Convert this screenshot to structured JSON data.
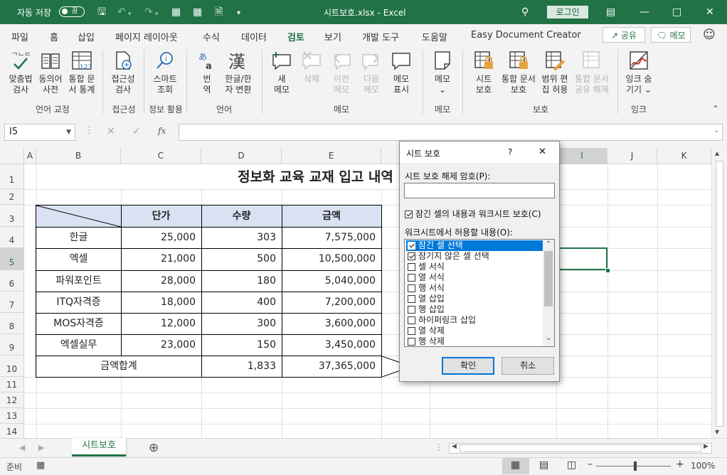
{
  "titlebar": {
    "autosave_label": "자동 저장",
    "autosave_state": "끔",
    "file_title": "시트보호.xlsx  -  Excel",
    "login_label": "로그인"
  },
  "menu": {
    "tabs": [
      "파일",
      "홈",
      "삽입",
      "페이지 레이아웃",
      "수식",
      "데이터",
      "검토",
      "보기",
      "개발 도구",
      "도움말",
      "Easy Document Creator"
    ],
    "active_tab": "검토",
    "share_label": "공유",
    "comment_label": "메모"
  },
  "ribbon": {
    "buttons": [
      {
        "l1": "맞춤법",
        "l2": "검사",
        "icon": "spellcheck-icon"
      },
      {
        "l1": "동의어",
        "l2": "사전",
        "icon": "thesaurus-icon"
      },
      {
        "l1": "통합 문",
        "l2": "서 통계",
        "icon": "workbook-statistics-icon"
      },
      {
        "l1": "접근성",
        "l2": "검사",
        "icon": "accessibility-icon"
      },
      {
        "l1": "스마트",
        "l2": "조회",
        "icon": "smart-lookup-icon"
      },
      {
        "l1": "번",
        "l2": "역",
        "icon": "translate-icon"
      },
      {
        "l1": "한글/한",
        "l2": "자 변환",
        "icon": "hangul-hanja-icon"
      },
      {
        "l1": "새",
        "l2": "메모",
        "icon": "new-comment-icon"
      },
      {
        "l1": "삭제",
        "l2": "",
        "icon": "delete-comment-icon",
        "disabled": true
      },
      {
        "l1": "이전",
        "l2": "메모",
        "icon": "previous-comment-icon",
        "disabled": true
      },
      {
        "l1": "다음",
        "l2": "메모",
        "icon": "next-comment-icon",
        "disabled": true
      },
      {
        "l1": "메모",
        "l2": "표시",
        "icon": "show-comments-icon"
      },
      {
        "l1": "메모",
        "l2": "⌄",
        "icon": "notes-icon"
      },
      {
        "l1": "시트",
        "l2": "보호",
        "icon": "protect-sheet-icon"
      },
      {
        "l1": "통합 문서",
        "l2": "보호",
        "icon": "protect-workbook-icon"
      },
      {
        "l1": "범위 편",
        "l2": "집 허용",
        "icon": "allow-edit-ranges-icon"
      },
      {
        "l1": "통합 문서",
        "l2": "공유 해제",
        "icon": "unshare-workbook-icon",
        "disabled": true
      },
      {
        "l1": "잉크 숨",
        "l2": "기기 ⌄",
        "icon": "hide-ink-icon"
      }
    ],
    "groups": [
      "언어 교정",
      "접근성",
      "정보 활용",
      "언어",
      "메모",
      "메모",
      "보호",
      "잉크"
    ]
  },
  "formula_bar": {
    "name_box": "I5",
    "fx": "fx",
    "formula": ""
  },
  "sheet": {
    "columns": [
      "A",
      "B",
      "C",
      "D",
      "E",
      "F",
      "G",
      "H",
      "I",
      "J",
      "K"
    ],
    "rows": [
      "1",
      "2",
      "3",
      "4",
      "5",
      "6",
      "7",
      "8",
      "9",
      "10",
      "11",
      "12",
      "13",
      "14"
    ],
    "selected_col": "I",
    "selected_row": "5",
    "title": "정보화 교육 교재 입고 내역",
    "headers": [
      "단가",
      "수량",
      "금액"
    ],
    "items": [
      {
        "name": "한글",
        "price": "25,000",
        "qty": "303",
        "amount": "7,575,000"
      },
      {
        "name": "엑셀",
        "price": "21,000",
        "qty": "500",
        "amount": "10,500,000"
      },
      {
        "name": "파워포인트",
        "price": "28,000",
        "qty": "180",
        "amount": "5,040,000"
      },
      {
        "name": "ITQ자격증",
        "price": "18,000",
        "qty": "400",
        "amount": "7,200,000"
      },
      {
        "name": "MOS자격증",
        "price": "12,000",
        "qty": "300",
        "amount": "3,600,000"
      },
      {
        "name": "엑셀실무",
        "price": "23,000",
        "qty": "150",
        "amount": "3,450,000"
      }
    ],
    "total": {
      "label": "금액합계",
      "qty": "1,833",
      "amount": "37,365,000"
    }
  },
  "dialog": {
    "title": "시트 보호",
    "help": "?",
    "close": "✕",
    "password_label": "시트 보호 해제 암호(P):",
    "password_value": "",
    "protect_label": "잠긴 셀의 내용과 워크시트 보호(C)",
    "protect_checked": true,
    "allow_label": "워크시트에서 허용할 내용(O):",
    "permissions": [
      {
        "label": "잠긴 셀 선택",
        "checked": true
      },
      {
        "label": "잠기지 않은 셀 선택",
        "checked": true
      },
      {
        "label": "셀 서식",
        "checked": false
      },
      {
        "label": "열 서식",
        "checked": false
      },
      {
        "label": "행 서식",
        "checked": false
      },
      {
        "label": "열 삽입",
        "checked": false
      },
      {
        "label": "행 삽입",
        "checked": false
      },
      {
        "label": "하이퍼링크 삽입",
        "checked": false
      },
      {
        "label": "열 삭제",
        "checked": false
      },
      {
        "label": "행 삭제",
        "checked": false
      }
    ],
    "ok_label": "확인",
    "cancel_label": "취소"
  },
  "sheet_tabs": {
    "active": "시트보호"
  },
  "status": {
    "ready": "준비",
    "zoom": "100%"
  }
}
